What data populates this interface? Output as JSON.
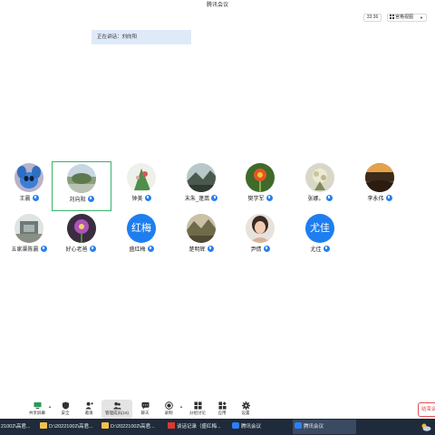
{
  "window": {
    "title": "腾讯会议",
    "time": "33:36",
    "view_label": "宫格视图"
  },
  "speaking": {
    "label": "正在讲话：刘向阳"
  },
  "participants": [
    {
      "name": "王晨",
      "avatar": "photo"
    },
    {
      "name": "刘向阳",
      "avatar": "photo"
    },
    {
      "name": "钟美",
      "avatar": "photo"
    },
    {
      "name": "末朱_蓬蒿",
      "avatar": "photo"
    },
    {
      "name": "樊学军",
      "avatar": "photo"
    },
    {
      "name": "张娜。",
      "avatar": "photo"
    },
    {
      "name": "李永伟",
      "avatar": "photo"
    },
    {
      "name": "五家渠陈晨",
      "avatar": "photo"
    },
    {
      "name": "好心老爸",
      "avatar": "photo"
    },
    {
      "name": "盛红梅",
      "avatar": "text",
      "avatar_text": "红梅",
      "avatar_color": "#1e7ef0"
    },
    {
      "name": "楚明辉",
      "avatar": "photo"
    },
    {
      "name": "尹倩",
      "avatar": "photo"
    },
    {
      "name": "尤佳",
      "avatar": "text",
      "avatar_text": "尤佳",
      "avatar_color": "#1e7ef0"
    }
  ],
  "toolbar": {
    "items": [
      {
        "label": "共享屏幕",
        "icon": "screen-share-icon"
      },
      {
        "label": "安全",
        "icon": "shield-icon"
      },
      {
        "label": "邀请",
        "icon": "invite-user-icon"
      },
      {
        "label": "管理成员(16)",
        "icon": "members-icon"
      },
      {
        "label": "聊天",
        "icon": "chat-icon"
      },
      {
        "label": "录制",
        "icon": "record-icon"
      },
      {
        "label": "分组讨论",
        "icon": "breakout-icon"
      },
      {
        "label": "应用",
        "icon": "apps-icon"
      },
      {
        "label": "设置",
        "icon": "gear-icon"
      }
    ],
    "end_label": "结束会"
  },
  "taskbar": {
    "items": [
      {
        "label": "21002\\高君...",
        "icon": "folder-icon"
      },
      {
        "label": "D:\\20221002\\高君...",
        "icon": "folder-icon"
      },
      {
        "label": "D:\\20221002\\高君...",
        "icon": "folder-icon"
      },
      {
        "label": "谈话记录（盛红梅...",
        "icon": "wps-icon"
      },
      {
        "label": "腾讯会议",
        "icon": "meeting-icon"
      },
      {
        "label": "腾讯会议",
        "icon": "meeting-icon"
      }
    ]
  },
  "colors": {
    "accent": "#1e7ef0",
    "active_border": "#36b36a",
    "end_red": "#e05050",
    "taskbar": "#1f2a3a"
  }
}
